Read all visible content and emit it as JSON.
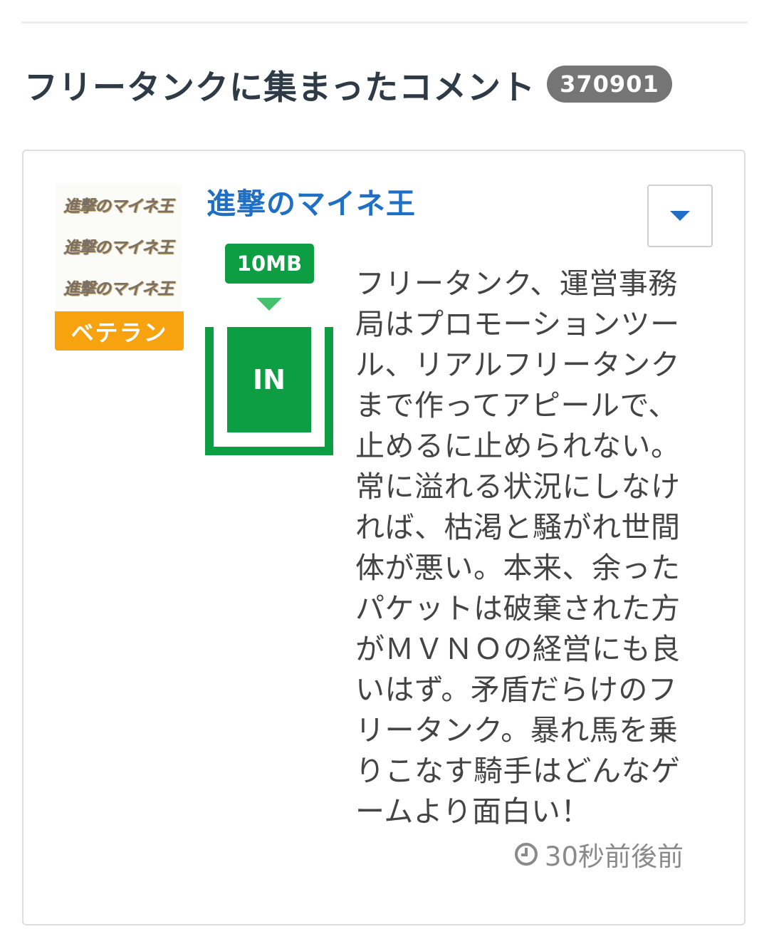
{
  "section": {
    "title": "フリータンクに集まったコメント",
    "count": "370901"
  },
  "comment": {
    "avatar_logo_text": "進撃のマイネ王",
    "rank_badge": "ベテラン",
    "username": "進撃のマイネ王",
    "amount": "10MB",
    "direction": "IN",
    "body": "フリータンク、運営事務局はプロモーションツール、リアルフリータンクまで作ってアピールで、止めるに止められない。常に溢れる状況にしなければ、枯渇と騒がれ世間体が悪い。本来、余ったパケットは破棄された方がＭＶＮＯの経営にも良いはず。矛盾だらけのフリータンク。暴れ馬を乗りこなす騎手はどんなゲームより面白い！",
    "timestamp": "30秒前後前"
  },
  "colors": {
    "accent_blue": "#1f6fc5",
    "tank_green": "#0d9d43",
    "rank_orange": "#f7a310",
    "count_gray": "#757575"
  },
  "icons": {
    "menu": "chevron-down-icon",
    "time": "clock-icon"
  }
}
